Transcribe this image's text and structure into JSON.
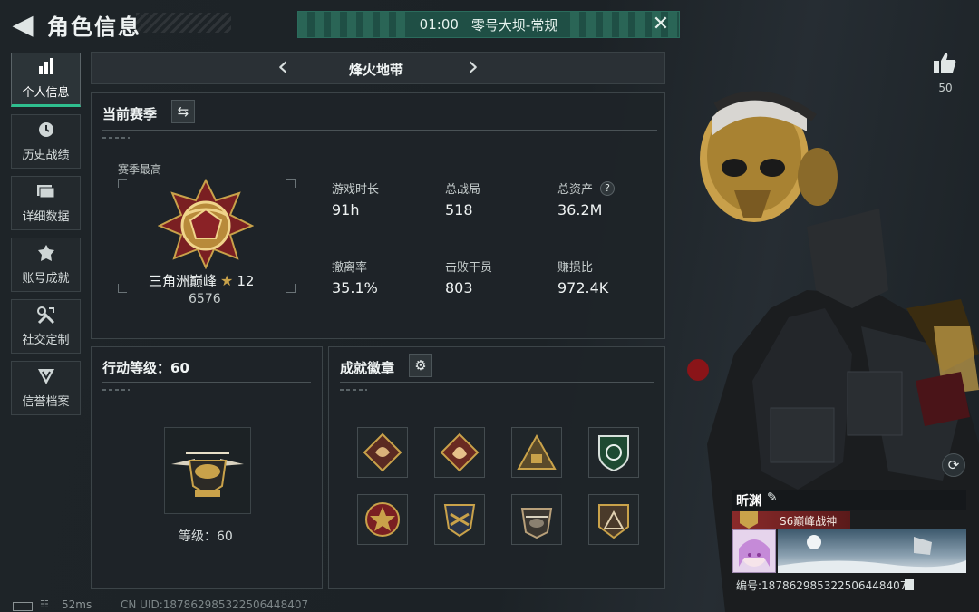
{
  "header": {
    "title": "角色信息"
  },
  "banner": {
    "time": "01:00",
    "mode": "零号大坝-常规"
  },
  "nav": {
    "items": [
      {
        "label": "个人信息",
        "icon": "bar-chart-icon"
      },
      {
        "label": "历史战绩",
        "icon": "clock-icon"
      },
      {
        "label": "详细数据",
        "icon": "folder-icon"
      },
      {
        "label": "账号成就",
        "icon": "achievement-icon"
      },
      {
        "label": "社交定制",
        "icon": "tools-icon"
      },
      {
        "label": "信誉档案",
        "icon": "credit-icon"
      }
    ]
  },
  "season_tab": {
    "title": "烽火地带"
  },
  "season": {
    "title": "当前赛季",
    "best_label": "赛季最高",
    "rank_name": "三角洲巅峰",
    "rank_stars": "12",
    "rank_score": "6576",
    "stats": [
      {
        "label": "游戏时长",
        "value": "91h"
      },
      {
        "label": "总战局",
        "value": "518"
      },
      {
        "label": "总资产",
        "value": "36.2M"
      },
      {
        "label": "撤离率",
        "value": "35.1%"
      },
      {
        "label": "击败干员",
        "value": "803"
      },
      {
        "label": "赚损比",
        "value": "972.4K"
      }
    ],
    "help": "?"
  },
  "action_level": {
    "title": "行动等级：60",
    "level_text": "等级：60"
  },
  "badges": {
    "title": "成就徽章"
  },
  "profile": {
    "name": "昕渊",
    "title": "S6巅峰战神",
    "id_text": "编号:1878629853225064484​07",
    "likes": "50"
  },
  "footer": {
    "ping": "52ms",
    "uid": "CN UID:1878629853225064484​07"
  },
  "colors": {
    "accent": "#2fbf8f",
    "banner": "#1f4f45",
    "panel": "#1e2428",
    "gold": "#c9a24a"
  }
}
